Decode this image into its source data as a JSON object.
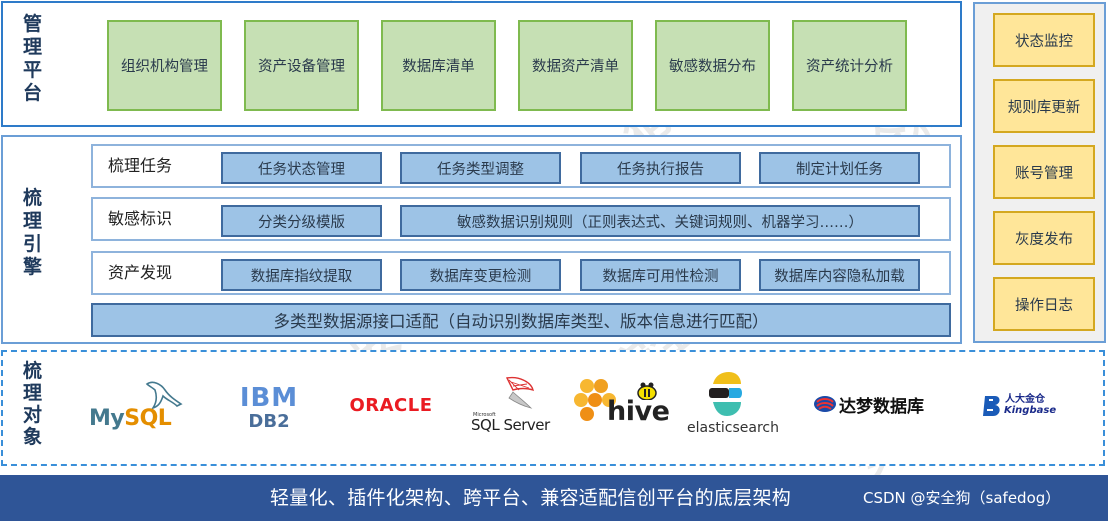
{
  "management": {
    "label": [
      "管",
      "理",
      "平",
      "台"
    ],
    "modules": [
      "组织机构管理",
      "资产设备管理",
      "数据库清单",
      "数据资产清单",
      "敏感数据分布",
      "资产统计分析"
    ]
  },
  "engine": {
    "label": [
      "梳",
      "理",
      "引",
      "擎"
    ],
    "rows": [
      {
        "label": "梳理任务",
        "items": [
          "任务状态管理",
          "任务类型调整",
          "任务执行报告",
          "制定计划任务"
        ]
      },
      {
        "label": "敏感标识",
        "items": [
          "分类分级模版",
          "敏感数据识别规则（正则表达式、关键词规则、机器学习……）"
        ]
      },
      {
        "label": "资产发现",
        "items": [
          "数据库指纹提取",
          "数据库变更检测",
          "数据库可用性检测",
          "数据库内容隐私加载"
        ]
      }
    ],
    "adapter": "多类型数据源接口适配（自动识别数据库类型、版本信息进行匹配）"
  },
  "side_panel": {
    "items": [
      "状态监控",
      "规则库更新",
      "账号管理",
      "灰度发布",
      "操作日志"
    ]
  },
  "targets": {
    "label": [
      "梳",
      "理",
      "对",
      "象"
    ],
    "logos": [
      {
        "name": "MySQL",
        "text_a": "My",
        "text_b": "SQL",
        "icon": "dolphin-icon"
      },
      {
        "name": "IBM DB2",
        "text_a": "IBM",
        "text_b": "DB2",
        "icon": "ibm-stripes-icon"
      },
      {
        "name": "Oracle",
        "text_a": "ORACLE",
        "icon": "oracle-wordmark"
      },
      {
        "name": "SQL Server",
        "text_a": "Microsoft",
        "text_b": "SQL Server",
        "icon": "sql-server-icon"
      },
      {
        "name": "Hive",
        "text_a": "hive",
        "icon": "hive-honeycomb-icon"
      },
      {
        "name": "Elasticsearch",
        "text_a": "elasticsearch",
        "icon": "elastic-icon"
      },
      {
        "name": "达梦数据库",
        "text_a": "达梦数据库",
        "icon": "dameng-icon"
      },
      {
        "name": "Kingbase",
        "text_a": "人大金仓",
        "text_b": "Kingbase",
        "icon": "kingbase-icon"
      }
    ]
  },
  "footer": {
    "text": "轻量化、插件化架构、跨平台、兼容适配信创平台的底层架构",
    "credit": "CSDN @安全狗（safedog）"
  },
  "watermark": "安全狗",
  "colors": {
    "green_fill": "#c6e0b4",
    "green_border": "#7fba4f",
    "blue_fill": "#9dc3e6",
    "blue_border": "#3f6a9e",
    "yellow_fill": "#ffe699",
    "yellow_border": "#d4a820",
    "footer_bg": "#2f5597",
    "frame_blue": "#2e7bc9"
  }
}
